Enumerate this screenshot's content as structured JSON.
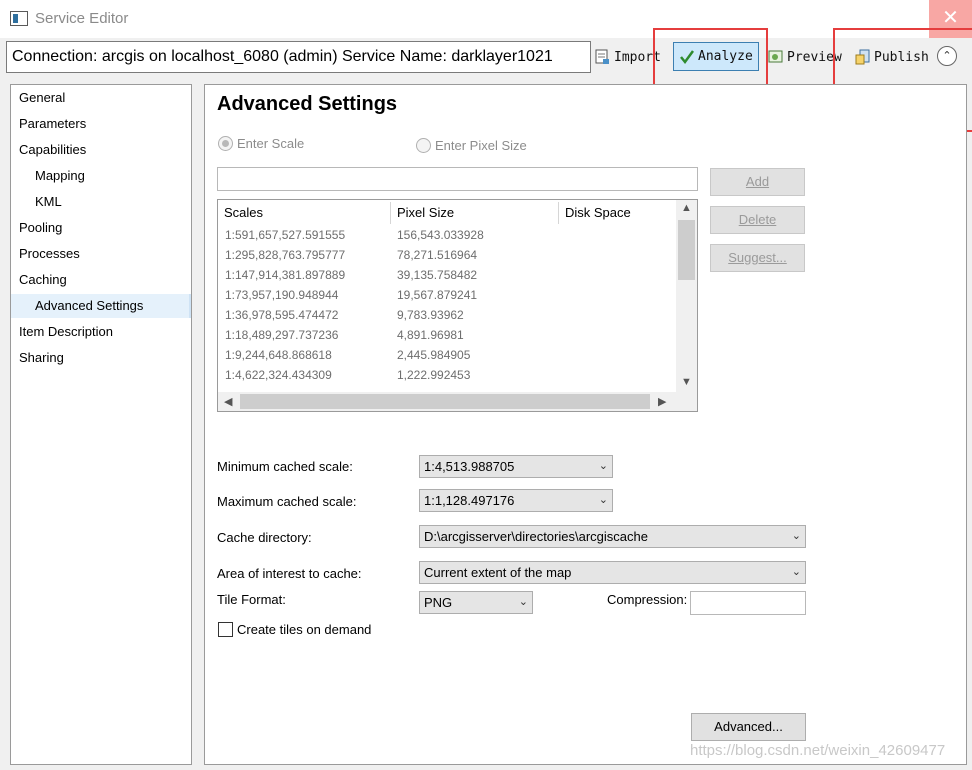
{
  "window": {
    "title": "Service Editor",
    "close": "✕"
  },
  "header": {
    "connection": "Connection: arcgis on localhost_6080 (admin)   Service Name: darklayer1021",
    "import_label": "Import",
    "analyze_label": "Analyze",
    "preview_label": "Preview",
    "publish_label": "Publish",
    "collapse_glyph": "⌃"
  },
  "nav": {
    "items": [
      {
        "label": "General"
      },
      {
        "label": "Parameters"
      },
      {
        "label": "Capabilities"
      },
      {
        "label": "Mapping"
      },
      {
        "label": "KML"
      },
      {
        "label": "Pooling"
      },
      {
        "label": "Processes"
      },
      {
        "label": "Caching"
      },
      {
        "label": "Advanced Settings"
      },
      {
        "label": "Item Description"
      },
      {
        "label": "Sharing"
      }
    ]
  },
  "content": {
    "title": "Advanced Settings",
    "radio_scale": "Enter Scale",
    "radio_pixel": "Enter Pixel Size",
    "add_label": "Add",
    "delete_label": "Delete",
    "suggest_label": "Suggest...",
    "table": {
      "headers": [
        "Scales",
        "Pixel Size",
        "Disk Space"
      ],
      "rows": [
        [
          "1:591,657,527.591555",
          "156,543.033928"
        ],
        [
          "1:295,828,763.795777",
          "78,271.516964"
        ],
        [
          "1:147,914,381.897889",
          "39,135.758482"
        ],
        [
          "1:73,957,190.948944",
          "19,567.879241"
        ],
        [
          "1:36,978,595.474472",
          "9,783.93962"
        ],
        [
          "1:18,489,297.737236",
          "4,891.96981"
        ],
        [
          "1:9,244,648.868618",
          "2,445.984905"
        ],
        [
          "1:4,622,324.434309",
          "1,222.992453"
        ]
      ]
    },
    "min_scale_label": "Minimum cached scale:",
    "min_scale_value": "1:4,513.988705",
    "max_scale_label": "Maximum cached scale:",
    "max_scale_value": "1:1,128.497176",
    "cache_dir_label": "Cache directory:",
    "cache_dir_value": "D:\\arcgisserver\\directories\\arcgiscache",
    "aoi_label": "Area of interest to cache:",
    "aoi_value": "Current extent of the map",
    "tile_format_label": "Tile Format:",
    "tile_format_value": "PNG",
    "compression_label": "Compression:",
    "create_tiles_label": "Create tiles on demand",
    "advanced_label": "Advanced..."
  },
  "watermark": "https://blog.csdn.net/weixin_42609477",
  "colors": {
    "highlight_red": "#e53d3d",
    "analyze_bg": "#cde8fb",
    "selected_nav": "#e5f1fb"
  }
}
